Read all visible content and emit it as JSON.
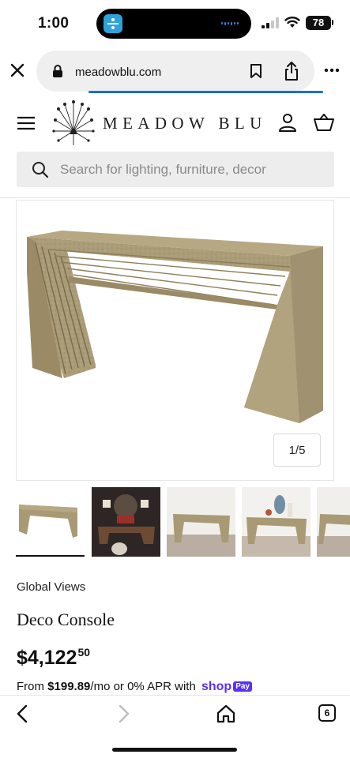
{
  "status_bar": {
    "time": "1:00",
    "battery": "78"
  },
  "browser": {
    "url": "meadowblu.com",
    "icons": [
      "close-icon",
      "lock-icon",
      "bookmark-icon",
      "share-icon",
      "more-icon"
    ]
  },
  "site_header": {
    "logo_text": "MEADOW BLU",
    "icons": [
      "menu-icon",
      "logo-mark",
      "account-icon",
      "cart-icon"
    ]
  },
  "search": {
    "placeholder": "Search for lighting, furniture, decor"
  },
  "gallery": {
    "counter": "1/5",
    "thumbnail_count": 5,
    "active_thumbnail": 1
  },
  "product": {
    "brand": "Global Views",
    "title": "Deco Console",
    "price_main": "$4,122",
    "price_cents": "50",
    "financing_prefix": "From",
    "financing_amount": "$199.89",
    "financing_middle": "/mo or 0% APR with",
    "shop_pay_logo": "shop",
    "shop_pay_badge": "Pay"
  },
  "bottom_bar": {
    "tabs_count": "6",
    "icons": [
      "back-icon",
      "forward-icon",
      "home-icon",
      "tabs-icon"
    ]
  },
  "colors": {
    "url_progress": "#1a6fd6",
    "shop_pay": "#5a31f4",
    "search_bg": "#ededed",
    "wood": "#a99a76"
  }
}
